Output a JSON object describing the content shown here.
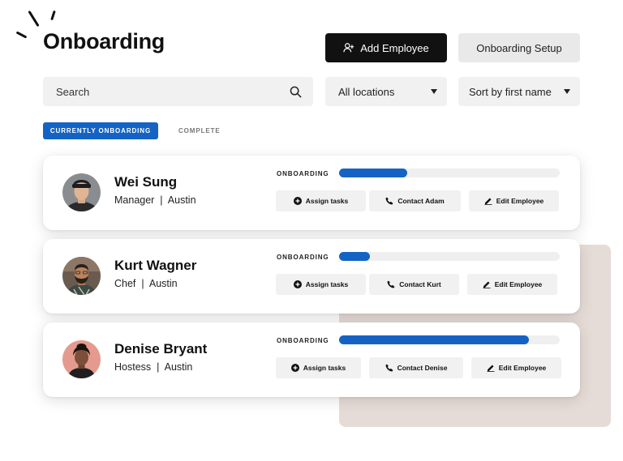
{
  "page": {
    "title": "Onboarding"
  },
  "toolbar": {
    "add_employee_label": "Add Employee",
    "onboarding_setup_label": "Onboarding Setup"
  },
  "search": {
    "placeholder": "Search",
    "value": ""
  },
  "filters": {
    "location": "All locations",
    "sort": "Sort by first name"
  },
  "tabs": [
    {
      "label": "CURRENTLY ONBOARDING",
      "active": true
    },
    {
      "label": "COMPLETE",
      "active": false
    }
  ],
  "employees": [
    {
      "name": "Wei Sung",
      "role": "Manager",
      "location": "Austin",
      "subtitle": "Manager  |  Austin",
      "status": "ONBOARDING",
      "progress": 0.31,
      "assign_label": "Assign tasks",
      "contact_label": "Contact Adam",
      "edit_label": "Edit Employee"
    },
    {
      "name": "Kurt Wagner",
      "role": "Chef",
      "location": "Austin",
      "subtitle": "Chef  |  Austin",
      "status": "ONBOARDING",
      "progress": 0.14,
      "assign_label": "Assign tasks",
      "contact_label": "Contact Kurt",
      "edit_label": "Edit Employee"
    },
    {
      "name": "Denise Bryant",
      "role": "Hostess",
      "location": "Austin",
      "subtitle": "Hostess  |  Austin",
      "status": "ONBOARDING",
      "progress": 0.86,
      "assign_label": "Assign tasks",
      "contact_label": "Contact Denise",
      "edit_label": "Edit Employee"
    }
  ],
  "icons": {
    "add_employee": "user-add-icon",
    "search": "search-icon",
    "caret": "chevron-down-icon",
    "assign": "plus-circle-icon",
    "contact": "phone-icon",
    "edit": "pencil-icon"
  },
  "colors": {
    "accent": "#1463c4",
    "primary_button": "#111111",
    "surface": "#f1f1f1",
    "backdrop": "#e6dcd7"
  }
}
